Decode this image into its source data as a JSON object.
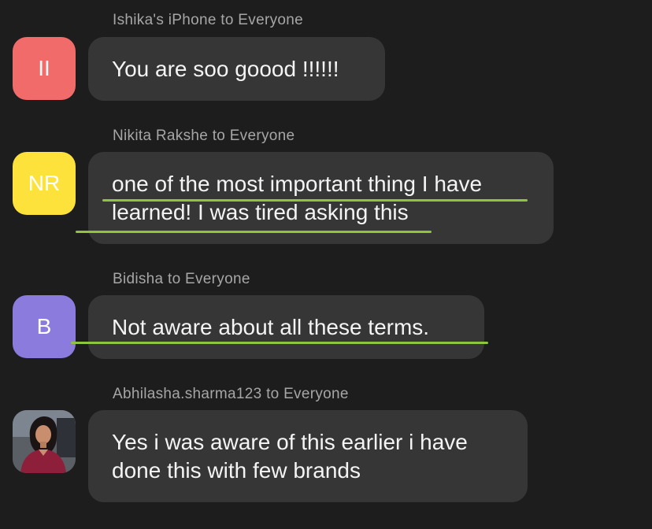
{
  "messages": [
    {
      "sender": "Ishika's iPhone to Everyone",
      "avatar_initials": "II",
      "avatar_color": "#f26b6b",
      "lines": [
        "You are soo goood !!!!!!"
      ]
    },
    {
      "sender": "Nikita Rakshe to Everyone",
      "avatar_initials": "NR",
      "avatar_color": "#fde23b",
      "lines": [
        "one of the most important thing I have",
        "learned! I was tired asking this"
      ]
    },
    {
      "sender": "Bidisha to Everyone",
      "avatar_initials": "B",
      "avatar_color": "#8b7bdc",
      "lines": [
        "Not aware about all these terms."
      ]
    },
    {
      "sender": "Abhilasha.sharma123 to Everyone",
      "avatar_initials": "",
      "avatar_icon": "profile-photo",
      "lines": [
        "Yes i was aware of this earlier i have",
        "done this with few brands"
      ]
    }
  ],
  "highlight_color": "#8cc63f"
}
